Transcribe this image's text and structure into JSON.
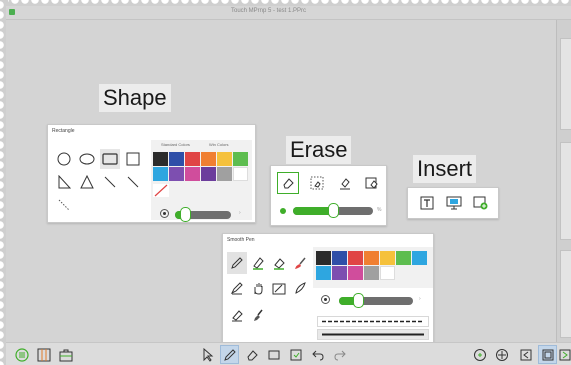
{
  "window": {
    "title": "Touch MPrnp 5 - test 1.PPrc"
  },
  "labels": {
    "shape": "Shape",
    "erase": "Erase",
    "insert": "Insert"
  },
  "shape_panel": {
    "title": "Rectangle",
    "tabs": [
      "Standard Colors",
      "Win Colors"
    ],
    "shapes": [
      "circle-icon",
      "ellipse-icon",
      "rounded-rectangle-icon",
      "square-icon",
      "right-triangle-icon",
      "triangle-icon",
      "line-icon",
      "line-icon",
      "dotted-line-icon"
    ],
    "selected_shape": "rounded-rectangle-icon",
    "swatches": [
      "#2b2b2b",
      "#2f4fa8",
      "#e04545",
      "#f07f32",
      "#f5c13c",
      "#5dbd4f",
      "#2ea6e0",
      "#7d4fb0",
      "#d04d9c",
      "#6c3d9c",
      "#a0a0a0",
      "#ffffff"
    ],
    "no_color_icon": "no-color-icon",
    "size_level": 0.18
  },
  "erase_panel": {
    "buttons": [
      "eraser-icon",
      "area-erase-icon",
      "erase-strokes-icon",
      "erase-all-icon"
    ],
    "selected": "eraser-icon",
    "unit": "%",
    "size_level": 0.5
  },
  "insert_panel": {
    "buttons": [
      "text-box-icon",
      "screen-capture-icon",
      "insert-image-icon"
    ]
  },
  "pen_panel": {
    "title": "Smooth Pen",
    "buttons": [
      "pen-icon",
      "highlighter-icon",
      "marker-icon",
      "brush-icon",
      "pencil-icon",
      "hand-icon",
      "calligraphy-icon",
      "feather-pen-icon",
      "chalk-icon",
      "stamp-brush-icon"
    ],
    "selected": "pen-icon",
    "swatches": [
      "#2b2b2b",
      "#2f4fa8",
      "#e04545",
      "#f07f32",
      "#f5c13c",
      "#5dbd4f",
      "#2ea6e0",
      "#2ea6e0",
      "#7d4fb0",
      "#d04d9c",
      "#a0a0a0",
      "#ffffff"
    ],
    "size_level": 0.25,
    "line_styles": [
      "dashed",
      "solid"
    ]
  },
  "toolbar": {
    "left": [
      "menu-icon",
      "page-sorter-icon",
      "toolbox-icon"
    ],
    "center": [
      "select-arrow-icon",
      "pen-tool-icon",
      "eraser-tool-icon",
      "shape-tool-icon",
      "insert-tool-icon",
      "undo-icon",
      "redo-icon"
    ],
    "center_selected": "pen-tool-icon",
    "right": [
      "zoom-icon",
      "pan-icon",
      "previous-page-icon",
      "page-view-icon",
      "next-page-icon"
    ],
    "right_selected": "page-view-icon"
  },
  "colors": {
    "accent": "#3fae2a",
    "selection": "#c3d6ea"
  }
}
